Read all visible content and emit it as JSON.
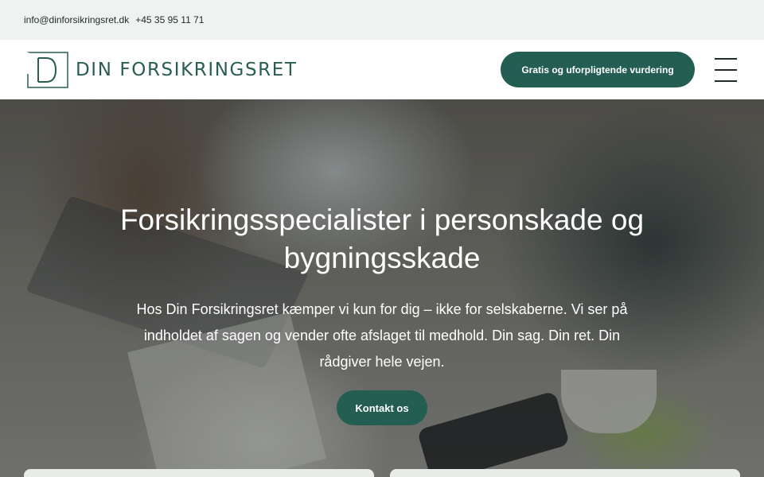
{
  "topbar": {
    "email": "info@dinforsikringsret.dk",
    "phone": "+45 35 95 11 71"
  },
  "header": {
    "logo_text": "DIN FORSIKRINGSRET",
    "cta_label": "Gratis og uforpligtende vurdering",
    "menu_icon": "hamburger-menu-icon"
  },
  "hero": {
    "title": "Forsikringsspecialister i personskade og bygningsskade",
    "subtitle": "Hos Din Forsikringsret kæmper vi kun for dig – ikke for selskaberne. Vi ser på indholdet af sagen og vender ofte afslaget til medhold. Din sag. Din ret. Din rådgiver hele vejen.",
    "cta_label": "Kontakt os"
  },
  "colors": {
    "brand_green": "#245e52",
    "topbar_bg": "#eef2f1",
    "logo_green": "#2a5e52"
  }
}
